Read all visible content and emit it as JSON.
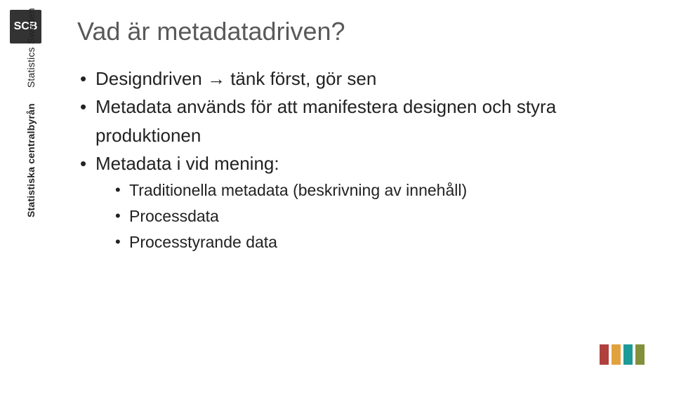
{
  "sidebar": {
    "logo_text": "SCB",
    "vertical_label_bold": "Statistiska centralbyrån",
    "vertical_label_thin": "Statistics Sweden"
  },
  "content": {
    "title": "Vad är metadatadriven?",
    "bullets": [
      {
        "prefix": "Designdriven ",
        "arrow": "→",
        "suffix": " tänk först, gör sen"
      },
      {
        "text": "Metadata används för att manifestera designen och styra produktionen"
      },
      {
        "text": "Metadata i vid mening:"
      }
    ],
    "sub_bullets": [
      {
        "text": "Traditionella metadata (beskrivning av innehåll)"
      },
      {
        "text": "Processdata"
      },
      {
        "text": "Processtyrande data"
      }
    ]
  }
}
